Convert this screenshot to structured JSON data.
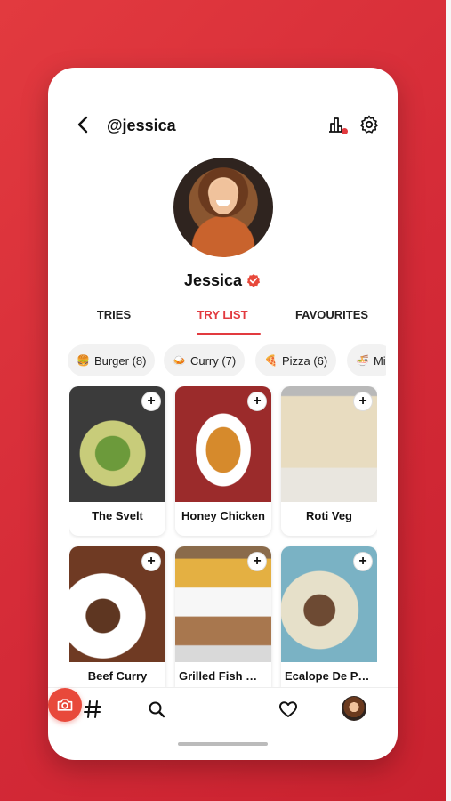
{
  "header": {
    "username": "@jessica",
    "back_icon": "back-arrow-icon",
    "stats_icon": "bar-chart-icon",
    "settings_icon": "gear-icon"
  },
  "profile": {
    "display_name": "Jessica",
    "verified": true,
    "accent_color": "#e23a3f"
  },
  "tabs": [
    {
      "label": "TRIES",
      "active": false
    },
    {
      "label": "TRY LIST",
      "active": true
    },
    {
      "label": "FAVOURITES",
      "active": false
    }
  ],
  "chips": [
    {
      "emoji": "🍔",
      "label": "Burger (8)"
    },
    {
      "emoji": "🍛",
      "label": "Curry (7)"
    },
    {
      "emoji": "🍕",
      "label": "Pizza (6)"
    },
    {
      "emoji": "🍜",
      "label": "Mi"
    }
  ],
  "cards": [
    {
      "label": "The Svelt"
    },
    {
      "label": "Honey Chicken"
    },
    {
      "label": "Roti Veg"
    },
    {
      "label": "Beef Curry"
    },
    {
      "label": "Grilled Fish Wit..."
    },
    {
      "label": "Ecalope De Po..."
    }
  ],
  "add_symbol": "+",
  "bottom_nav": [
    "hashtag-icon",
    "search-icon",
    "camera-icon",
    "heart-icon",
    "profile-avatar"
  ]
}
